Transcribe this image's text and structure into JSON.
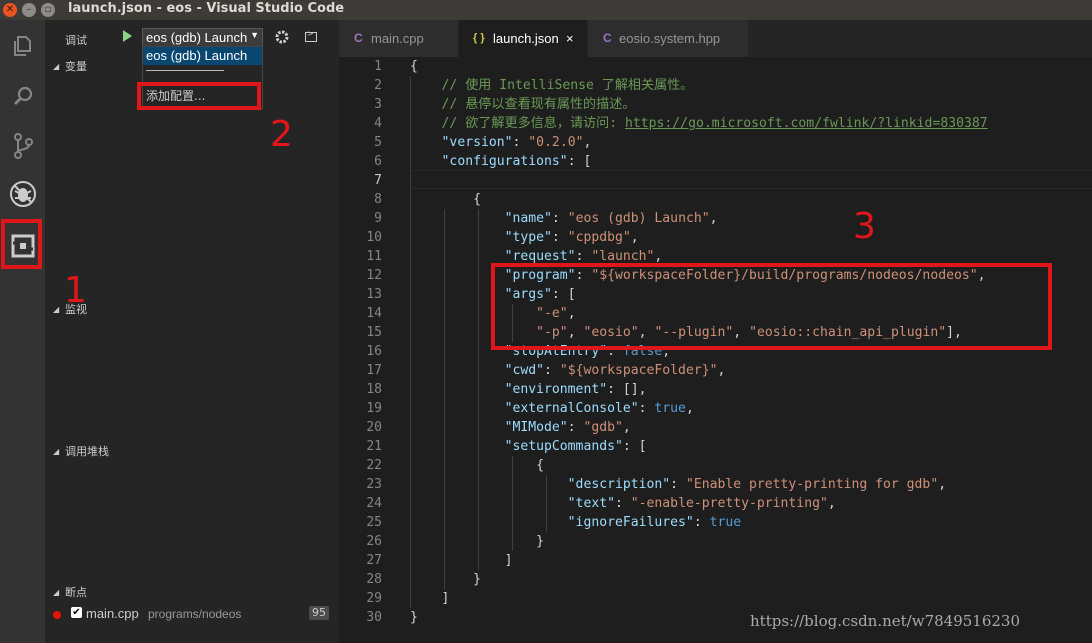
{
  "window": {
    "title": "launch.json - eos - Visual Studio Code"
  },
  "activity_bar": [
    "explorer",
    "search",
    "source-control",
    "debug",
    "extensions"
  ],
  "debug_toolbar": {
    "label": "调试",
    "config_selected": "eos (gdb) Launch"
  },
  "config_dropdown": {
    "option": "eos (gdb) Launch",
    "separator": "——————",
    "add_config": "添加配置..."
  },
  "sidebar": {
    "variables": "变量",
    "watch": "监视",
    "callstack": "调用堆栈",
    "breakpoints": "断点",
    "breakpoint": {
      "file": "main.cpp",
      "path": "programs/nodeos",
      "line": "95"
    }
  },
  "tabs": [
    {
      "icon": "C",
      "label": "main.cpp"
    },
    {
      "icon": "{ }",
      "label": "launch.json",
      "close": "×"
    },
    {
      "icon": "C",
      "label": "eosio.system.hpp"
    }
  ],
  "annotations": {
    "n1": "1",
    "n2": "2",
    "n3": "3"
  },
  "code": {
    "line_numbers": [
      "1",
      "2",
      "3",
      "4",
      "5",
      "6",
      "7",
      "8",
      "9",
      "10",
      "11",
      "12",
      "13",
      "14",
      "15",
      "16",
      "17",
      "18",
      "19",
      "20",
      "21",
      "22",
      "23",
      "24",
      "25",
      "26",
      "27",
      "28",
      "29",
      "30"
    ],
    "l1": "{",
    "l2": "// 使用 IntelliSense 了解相关属性。",
    "l3": "// 悬停以查看现有属性的描述。",
    "l4_comment": "// 欲了解更多信息，请访问: ",
    "l4_url": "https://go.microsoft.com/fwlink/?linkid=830387",
    "l5_key": "\"version\"",
    "l5_val": "\"0.2.0\"",
    "l6_key": "\"configurations\"",
    "name_key": "\"name\"",
    "name_val": "\"eos (gdb) Launch\"",
    "type_key": "\"type\"",
    "type_val": "\"cppdbg\"",
    "request_key": "\"request\"",
    "request_val": "\"launch\"",
    "program_key": "\"program\"",
    "program_val": "\"${workspaceFolder}/build/programs/nodeos/nodeos\"",
    "args_key": "\"args\"",
    "arg_e": "\"-e\"",
    "arg_p": "\"-p\"",
    "arg_eosio": "\"eosio\"",
    "arg_plugin": "\"--plugin\"",
    "arg_chain": "\"eosio::chain_api_plugin\"",
    "stop_key": "\"stopAtEntry\"",
    "stop_val": "false",
    "cwd_key": "\"cwd\"",
    "cwd_val": "\"${workspaceFolder}\"",
    "env_key": "\"environment\"",
    "ext_key": "\"externalConsole\"",
    "ext_val": "true",
    "mimode_key": "\"MIMode\"",
    "mimode_val": "\"gdb\"",
    "setup_key": "\"setupCommands\"",
    "desc_key": "\"description\"",
    "desc_val": "\"Enable pretty-printing for gdb\"",
    "text_key": "\"text\"",
    "text_val": "\"-enable-pretty-printing\"",
    "ignore_key": "\"ignoreFailures\"",
    "ignore_val": "true"
  },
  "watermark": "https://blog.csdn.net/w7849516230"
}
